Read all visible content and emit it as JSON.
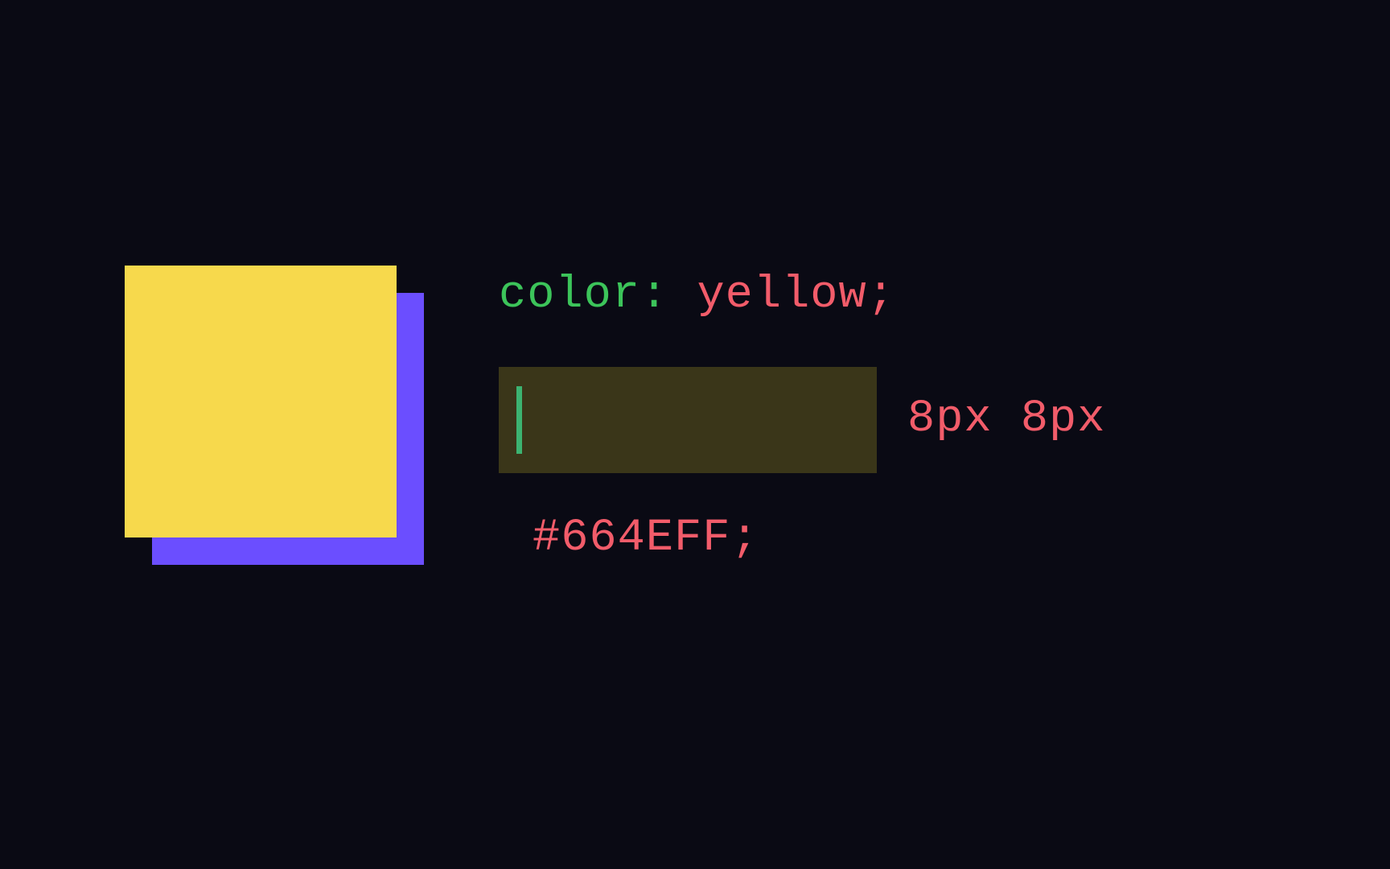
{
  "preview": {
    "main_color": "#f7d94c",
    "shadow_color": "#6b4eff"
  },
  "code": {
    "line1": {
      "property": "color",
      "colon": ":",
      "space": " ",
      "value": "yellow",
      "semicolon": ";"
    },
    "line2": {
      "after_input": "8px 8px"
    },
    "line3": {
      "value": "#664EFF",
      "semicolon": ";"
    }
  }
}
